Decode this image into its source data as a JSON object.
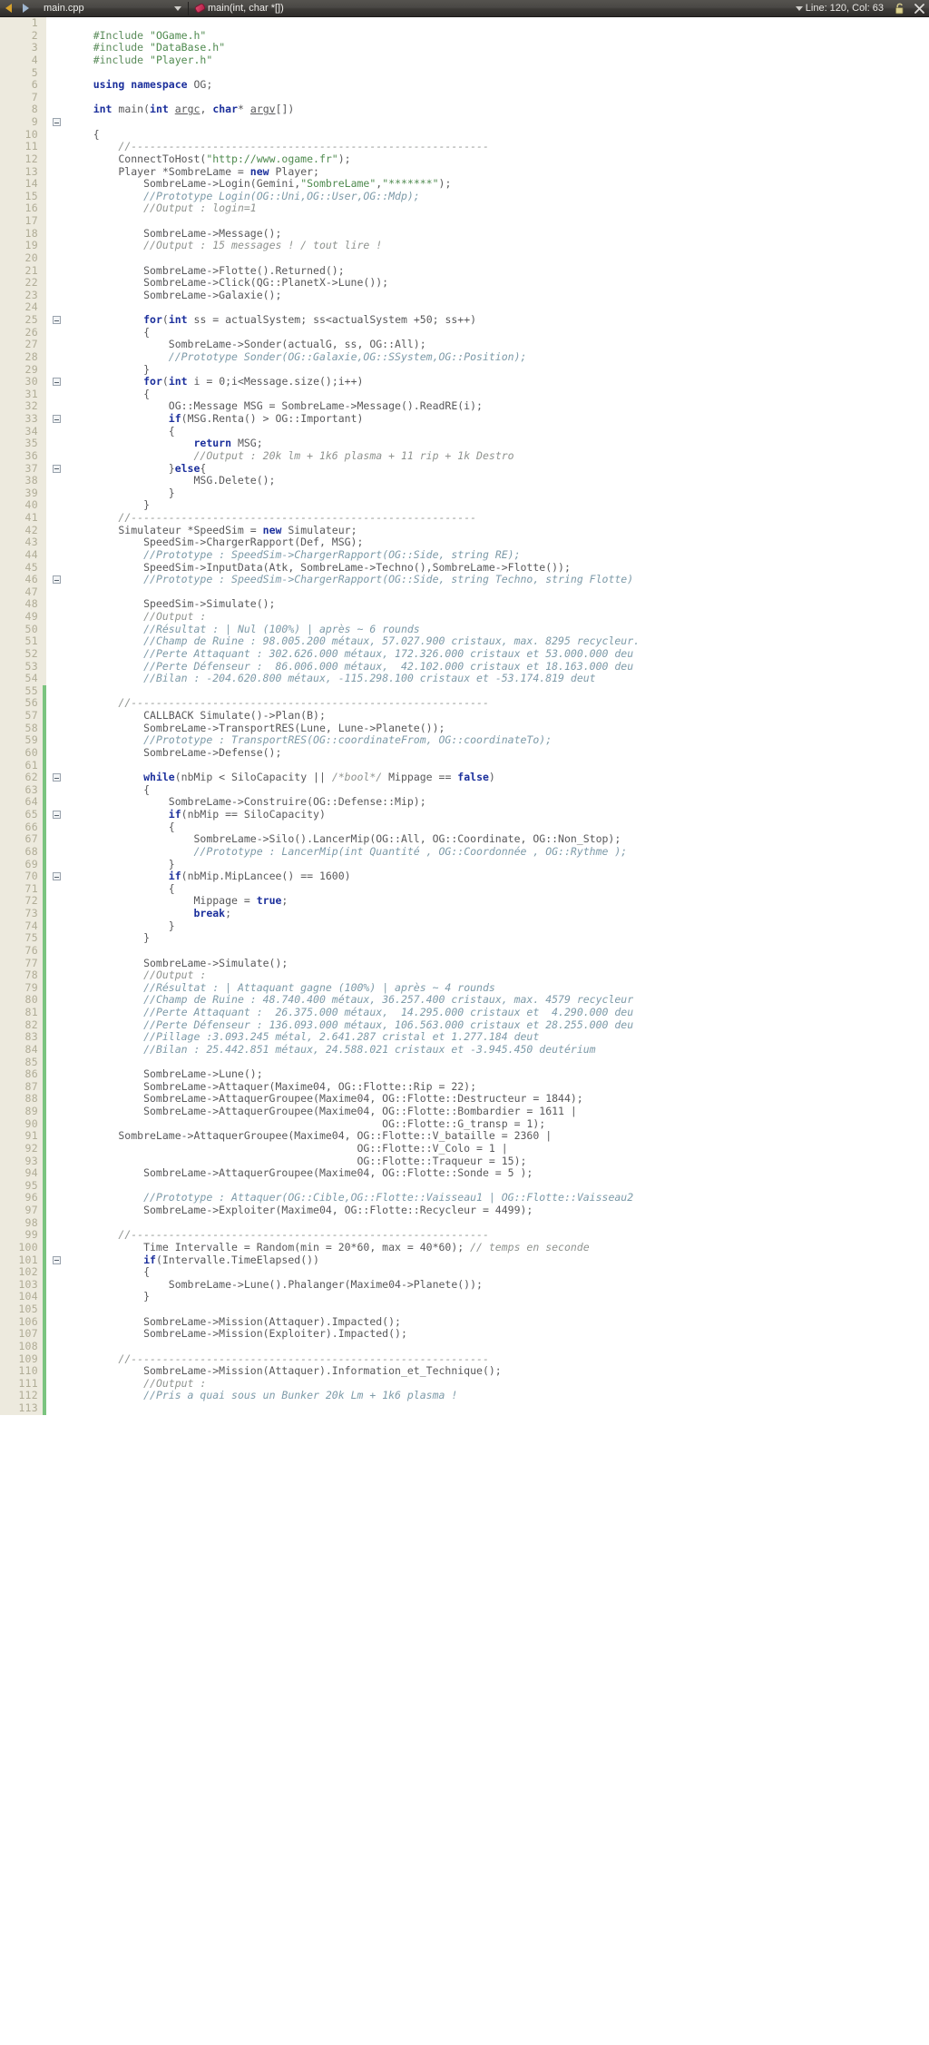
{
  "toolbar": {
    "back_icon": "arrow-left-icon",
    "forward_icon": "arrow-right-icon",
    "file_name": "main.cpp",
    "dropdown_icon": "chevron-down-icon",
    "symbol_icon": "method-icon",
    "symbol_name": "main(int, char *[])",
    "position_caret_icon": "chevron-down-icon",
    "position_label": "Line: 120, Col: 63",
    "lock_icon": "unlocked-padlock-icon",
    "close_icon": "close-icon"
  },
  "editor": {
    "first_line": 1,
    "last_line": 113,
    "fold_lines": [
      9,
      25,
      30,
      33,
      37,
      46,
      62,
      65,
      70,
      101
    ],
    "changed_gutter_from": 55,
    "lines": [
      {
        "n": 1,
        "code": ""
      },
      {
        "n": 2,
        "code": "    <span class=\"pre\">#Include</span> <span class=\"str\">\"OGame.h\"</span>"
      },
      {
        "n": 3,
        "code": "    <span class=\"pre\">#include</span> <span class=\"str\">\"DataBase.h\"</span>"
      },
      {
        "n": 4,
        "code": "    <span class=\"pre\">#include</span> <span class=\"str\">\"Player.h\"</span>"
      },
      {
        "n": 5,
        "code": ""
      },
      {
        "n": 6,
        "code": "    <span class=\"kw\">using namespace</span> OG;"
      },
      {
        "n": 7,
        "code": ""
      },
      {
        "n": 8,
        "code": "    <span class=\"kw\">int</span> main(<span class=\"kw\">int</span> <span class=\"un\">argc</span>, <span class=\"kw\">char</span>* <span class=\"un\">argv</span>[])"
      },
      {
        "n": 9,
        "code": ""
      },
      {
        "n": 10,
        "code": "    {"
      },
      {
        "n": 11,
        "code": "        <span class=\"cmt\">//---------------------------------------------------------</span>"
      },
      {
        "n": 12,
        "code": "        ConnectToHost(<span class=\"str\">\"http://www.ogame.fr\"</span>);"
      },
      {
        "n": 13,
        "code": "        Player *SombreLame = <span class=\"kw\">new</span> Player;"
      },
      {
        "n": 14,
        "code": "            SombreLame-&gt;Login(Gemini,<span class=\"str\">\"SombreLame\"</span>,<span class=\"str\">\"*******\"</span>);"
      },
      {
        "n": 15,
        "code": "            <span class=\"cmt2\">//Prototype Login(OG::Uni,OG::User,OG::Mdp);</span>"
      },
      {
        "n": 16,
        "code": "            <span class=\"cmt\">//Output : login=1</span>"
      },
      {
        "n": 17,
        "code": ""
      },
      {
        "n": 18,
        "code": "            SombreLame-&gt;Message();"
      },
      {
        "n": 19,
        "code": "            <span class=\"cmt\">//Output : 15 messages ! / tout lire !</span>"
      },
      {
        "n": 20,
        "code": ""
      },
      {
        "n": 21,
        "code": "            SombreLame-&gt;Flotte().Returned();"
      },
      {
        "n": 22,
        "code": "            SombreLame-&gt;Click(QG::PlanetX-&gt;Lune());"
      },
      {
        "n": 23,
        "code": "            SombreLame-&gt;Galaxie();"
      },
      {
        "n": 24,
        "code": ""
      },
      {
        "n": 25,
        "code": "            <span class=\"kw\">for</span>(<span class=\"kw\">int</span> ss = actualSystem; ss&lt;actualSystem +50; ss++)"
      },
      {
        "n": 26,
        "code": "            {"
      },
      {
        "n": 27,
        "code": "                SombreLame-&gt;Sonder(actualG, ss, OG::All);"
      },
      {
        "n": 28,
        "code": "                <span class=\"cmt2\">//Prototype Sonder(OG::Galaxie,OG::SSystem,OG::Position);</span>"
      },
      {
        "n": 29,
        "code": "            }"
      },
      {
        "n": 30,
        "code": "            <span class=\"kw\">for</span>(<span class=\"kw\">int</span> i = 0;i&lt;Message.size();i++)"
      },
      {
        "n": 31,
        "code": "            {"
      },
      {
        "n": 32,
        "code": "                OG::Message MSG = SombreLame-&gt;Message().ReadRE(i);"
      },
      {
        "n": 33,
        "code": "                <span class=\"kw\">if</span>(MSG.Renta() &gt; OG::Important)"
      },
      {
        "n": 34,
        "code": "                {"
      },
      {
        "n": 35,
        "code": "                    <span class=\"kw\">return</span> MSG;"
      },
      {
        "n": 36,
        "code": "                    <span class=\"cmt\">//Output : 20k lm + 1k6 plasma + 11 rip + 1k Destro</span>"
      },
      {
        "n": 37,
        "code": "                }<span class=\"kw\">else</span>{"
      },
      {
        "n": 38,
        "code": "                    MSG.Delete();"
      },
      {
        "n": 39,
        "code": "                }"
      },
      {
        "n": 40,
        "code": "            }"
      },
      {
        "n": 41,
        "code": "        <span class=\"cmt\">//-------------------------------------------------------</span>"
      },
      {
        "n": 42,
        "code": "        Simulateur *SpeedSim = <span class=\"kw\">new</span> Simulateur;"
      },
      {
        "n": 43,
        "code": "            SpeedSim-&gt;ChargerRapport(Def, MSG);"
      },
      {
        "n": 44,
        "code": "            <span class=\"cmt2\">//Prototype : SpeedSim-&gt;ChargerRapport(OG::Side, string RE);</span>"
      },
      {
        "n": 45,
        "code": "            SpeedSim-&gt;InputData(Atk, SombreLame-&gt;Techno(),SombreLame-&gt;Flotte());"
      },
      {
        "n": 46,
        "code": "            <span class=\"cmt2\">//Prototype : SpeedSim-&gt;ChargerRapport(OG::Side, string Techno, string Flotte)</span>"
      },
      {
        "n": 47,
        "code": ""
      },
      {
        "n": 48,
        "code": "            SpeedSim-&gt;Simulate();"
      },
      {
        "n": 49,
        "code": "            <span class=\"cmt\">//Output :</span>"
      },
      {
        "n": 50,
        "code": "            <span class=\"cmt2\">//Résultat : | Nul (100%) | après ~ 6 rounds</span>"
      },
      {
        "n": 51,
        "code": "            <span class=\"cmt2\">//Champ de Ruine : 98.005.200 métaux, 57.027.900 cristaux, max. 8295 recycleur.</span>"
      },
      {
        "n": 52,
        "code": "            <span class=\"cmt2\">//Perte Attaquant : 302.626.000 métaux, 172.326.000 cristaux et 53.000.000 deu</span>"
      },
      {
        "n": 53,
        "code": "            <span class=\"cmt2\">//Perte Défenseur :  86.006.000 métaux,  42.102.000 cristaux et 18.163.000 deu</span>"
      },
      {
        "n": 54,
        "code": "            <span class=\"cmt2\">//Bilan : -204.620.800 métaux, -115.298.100 cristaux et -53.174.819 deut</span>"
      },
      {
        "n": 55,
        "code": ""
      },
      {
        "n": 56,
        "code": "        <span class=\"cmt\">//---------------------------------------------------------</span>"
      },
      {
        "n": 57,
        "code": "            CALLBACK Simulate()-&gt;Plan(B);"
      },
      {
        "n": 58,
        "code": "            SombreLame-&gt;TransportRES(Lune, Lune-&gt;Planete());"
      },
      {
        "n": 59,
        "code": "            <span class=\"cmt2\">//Prototype : TransportRES(OG::coordinateFrom, OG::coordinateTo);</span>"
      },
      {
        "n": 60,
        "code": "            SombreLame-&gt;Defense();"
      },
      {
        "n": 61,
        "code": ""
      },
      {
        "n": 62,
        "code": "            <span class=\"kw\">while</span>(nbMip &lt; SiloCapacity || <span class=\"cmt\">/*bool*/</span> Mippage == <span class=\"kw\">false</span>)"
      },
      {
        "n": 63,
        "code": "            {"
      },
      {
        "n": 64,
        "code": "                SombreLame-&gt;Construire(OG::Defense::Mip);"
      },
      {
        "n": 65,
        "code": "                <span class=\"kw\">if</span>(nbMip == SiloCapacity)"
      },
      {
        "n": 66,
        "code": "                {"
      },
      {
        "n": 67,
        "code": "                    SombreLame-&gt;Silo().LancerMip(OG::All, OG::Coordinate, OG::Non_Stop);"
      },
      {
        "n": 68,
        "code": "                    <span class=\"cmt2\">//Prototype : LancerMip(int Quantité , OG::Coordonnée , OG::Rythme );</span>"
      },
      {
        "n": 69,
        "code": "                }"
      },
      {
        "n": 70,
        "code": "                <span class=\"kw\">if</span>(nbMip.MipLancee() == 1600)"
      },
      {
        "n": 71,
        "code": "                {"
      },
      {
        "n": 72,
        "code": "                    Mippage = <span class=\"kw\">true</span>;"
      },
      {
        "n": 73,
        "code": "                    <span class=\"kw\">break</span>;"
      },
      {
        "n": 74,
        "code": "                }"
      },
      {
        "n": 75,
        "code": "            }"
      },
      {
        "n": 76,
        "code": ""
      },
      {
        "n": 77,
        "code": "            SombreLame-&gt;Simulate();"
      },
      {
        "n": 78,
        "code": "            <span class=\"cmt\">//Output :</span>"
      },
      {
        "n": 79,
        "code": "            <span class=\"cmt2\">//Résultat : | Attaquant gagne (100%) | après ~ 4 rounds</span>"
      },
      {
        "n": 80,
        "code": "            <span class=\"cmt2\">//Champ de Ruine : 48.740.400 métaux, 36.257.400 cristaux, max. 4579 recycleur</span>"
      },
      {
        "n": 81,
        "code": "            <span class=\"cmt2\">//Perte Attaquant :  26.375.000 métaux,  14.295.000 cristaux et  4.290.000 deu</span>"
      },
      {
        "n": 82,
        "code": "            <span class=\"cmt2\">//Perte Défenseur : 136.093.000 métaux, 106.563.000 cristaux et 28.255.000 deu</span>"
      },
      {
        "n": 83,
        "code": "            <span class=\"cmt2\">//Pillage :3.093.245 métal, 2.641.287 cristal et 1.277.184 deut</span>"
      },
      {
        "n": 84,
        "code": "            <span class=\"cmt2\">//Bilan : 25.442.851 métaux, 24.588.021 cristaux et -3.945.450 deutérium</span>"
      },
      {
        "n": 85,
        "code": ""
      },
      {
        "n": 86,
        "code": "            SombreLame-&gt;Lune();"
      },
      {
        "n": 87,
        "code": "            SombreLame-&gt;Attaquer(Maxime04, OG::Flotte::Rip = 22);"
      },
      {
        "n": 88,
        "code": "            SombreLame-&gt;AttaquerGroupee(Maxime04, OG::Flotte::Destructeur = 1844);"
      },
      {
        "n": 89,
        "code": "            SombreLame-&gt;AttaquerGroupee(Maxime04, OG::Flotte::Bombardier = 1611 |"
      },
      {
        "n": 90,
        "code": "                                                  OG::Flotte::G_transp = 1);"
      },
      {
        "n": 91,
        "code": "        SombreLame-&gt;AttaquerGroupee(Maxime04, OG::Flotte::V_bataille = 2360 |"
      },
      {
        "n": 92,
        "code": "                                              OG::Flotte::V_Colo = 1 |"
      },
      {
        "n": 93,
        "code": "                                              OG::Flotte::Traqueur = 15);"
      },
      {
        "n": 94,
        "code": "            SombreLame-&gt;AttaquerGroupee(Maxime04, OG::Flotte::Sonde = 5 );"
      },
      {
        "n": 95,
        "code": ""
      },
      {
        "n": 96,
        "code": "            <span class=\"cmt2\">//Prototype : Attaquer(OG::Cible,OG::Flotte::Vaisseau1 | OG::Flotte::Vaisseau2</span>"
      },
      {
        "n": 97,
        "code": "            SombreLame-&gt;Exploiter(Maxime04, OG::Flotte::Recycleur = 4499);"
      },
      {
        "n": 98,
        "code": ""
      },
      {
        "n": 99,
        "code": "        <span class=\"cmt\">//---------------------------------------------------------</span>"
      },
      {
        "n": 100,
        "code": "            Time Intervalle = Random(min = 20*60, max = 40*60); <span class=\"cmt\">// temps en seconde</span>"
      },
      {
        "n": 101,
        "code": "            <span class=\"kw\">if</span>(Intervalle.TimeElapsed())"
      },
      {
        "n": 102,
        "code": "            {"
      },
      {
        "n": 103,
        "code": "                SombreLame-&gt;Lune().Phalanger(Maxime04-&gt;Planete());"
      },
      {
        "n": 104,
        "code": "            }"
      },
      {
        "n": 105,
        "code": ""
      },
      {
        "n": 106,
        "code": "            SombreLame-&gt;Mission(Attaquer).Impacted();"
      },
      {
        "n": 107,
        "code": "            SombreLame-&gt;Mission(Exploiter).Impacted();"
      },
      {
        "n": 108,
        "code": ""
      },
      {
        "n": 109,
        "code": "        <span class=\"cmt\">//---------------------------------------------------------</span>"
      },
      {
        "n": 110,
        "code": "            SombreLame-&gt;Mission(Attaquer).Information_et_Technique();"
      },
      {
        "n": 111,
        "code": "            <span class=\"cmt\">//Output :</span>"
      },
      {
        "n": 112,
        "code": "            <span class=\"cmt2\">//Pris a quai sous un Bunker 20k Lm + 1k6 plasma !</span>"
      },
      {
        "n": 113,
        "code": ""
      }
    ]
  }
}
